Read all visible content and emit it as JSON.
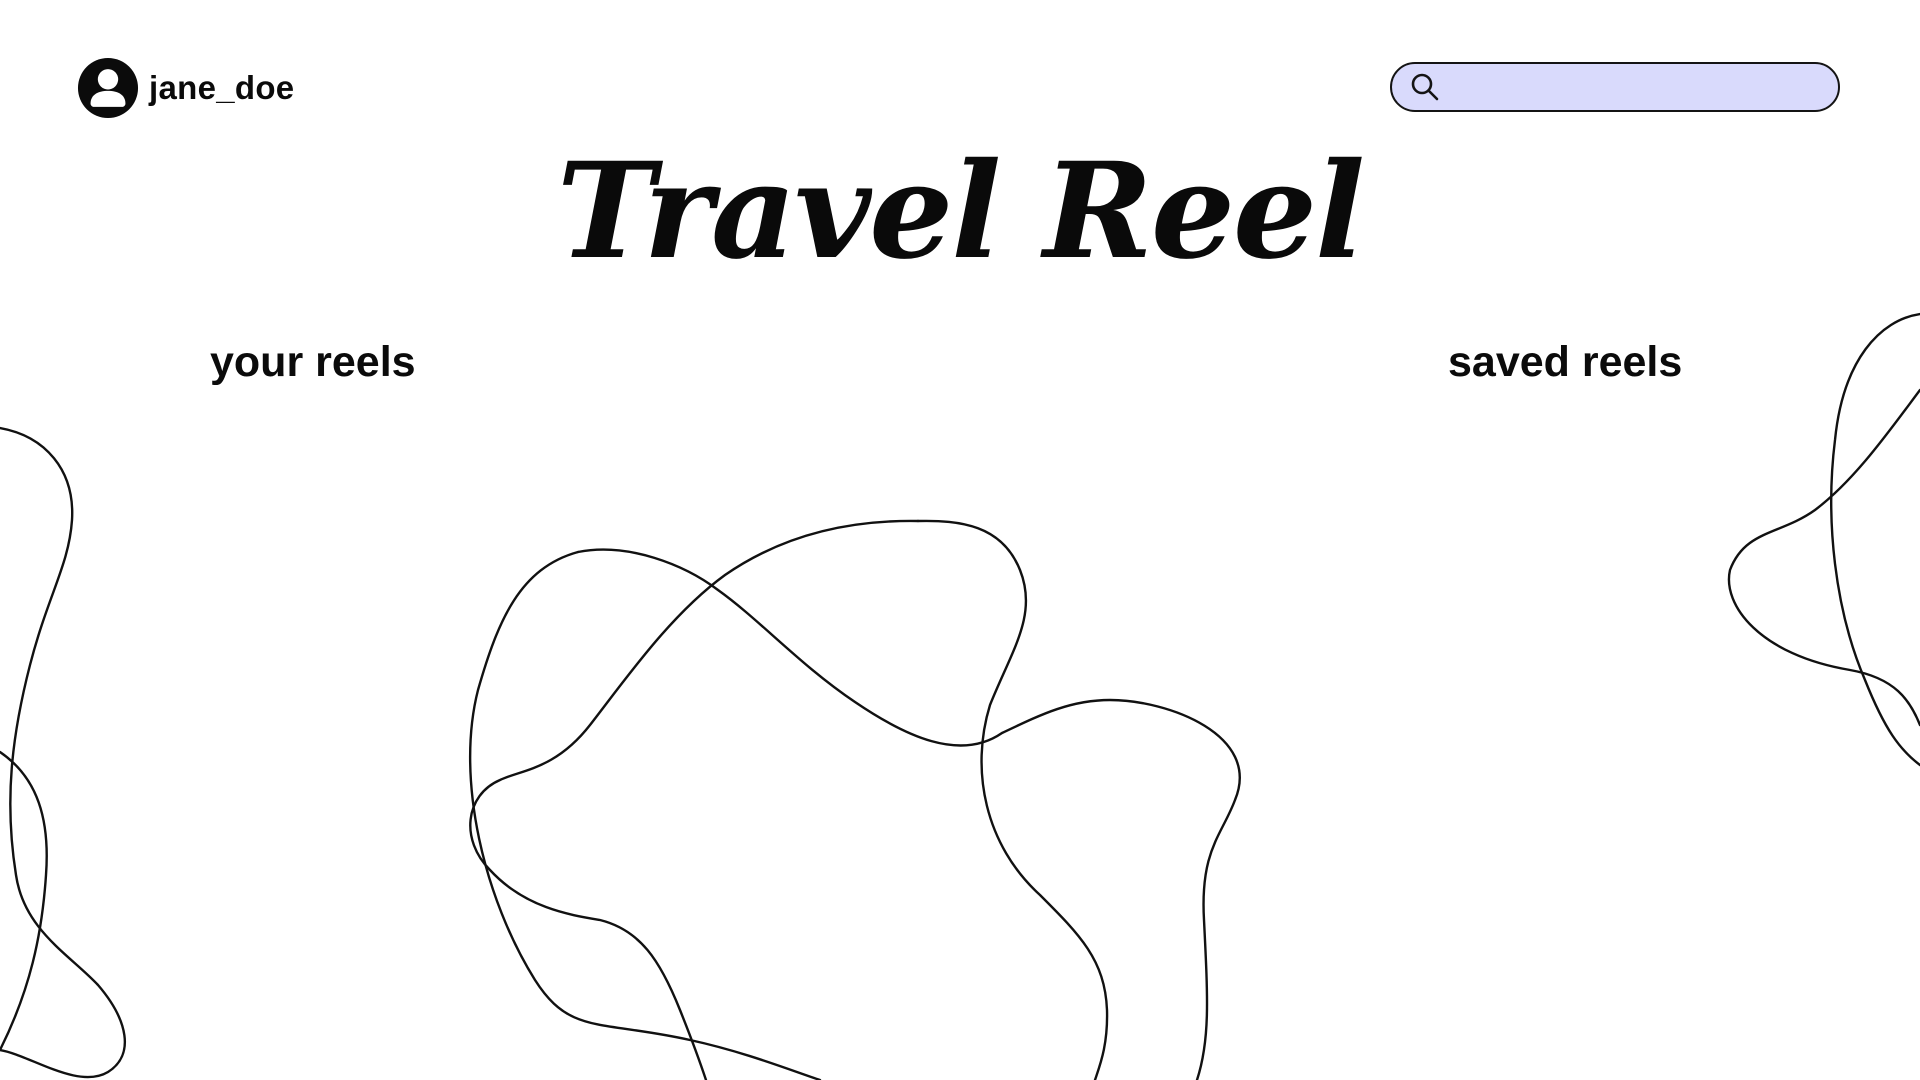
{
  "header": {
    "username": "jane_doe",
    "avatar_icon": "user-silhouette-icon",
    "search": {
      "value": "",
      "placeholder": "",
      "icon": "search-icon",
      "background": "#d9dafc"
    }
  },
  "main": {
    "title": "Travel Reel",
    "links": {
      "your_reels": "your reels",
      "saved_reels": "saved reels"
    }
  },
  "decoration": {
    "style": "hand-drawn line loops",
    "stroke_color": "#111111"
  }
}
